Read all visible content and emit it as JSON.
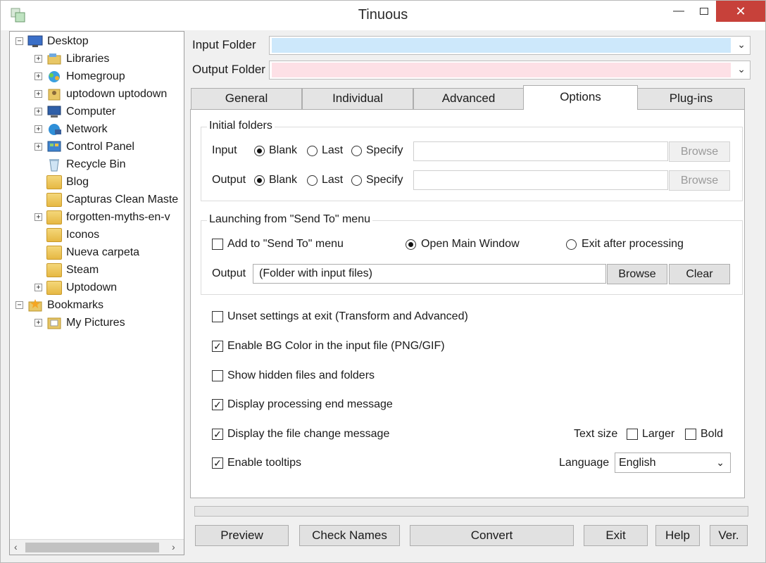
{
  "window": {
    "title": "Tinuous"
  },
  "tree": {
    "items": [
      {
        "label": "Desktop",
        "icon": "desktop-icon"
      },
      {
        "label": "Libraries",
        "icon": "libraries-icon"
      },
      {
        "label": "Homegroup",
        "icon": "homegroup-icon"
      },
      {
        "label": "uptodown uptodown",
        "icon": "user-folder-icon"
      },
      {
        "label": "Computer",
        "icon": "computer-icon"
      },
      {
        "label": "Network",
        "icon": "network-icon"
      },
      {
        "label": "Control Panel",
        "icon": "control-panel-icon"
      },
      {
        "label": "Recycle Bin",
        "icon": "recycle-bin-icon"
      },
      {
        "label": "Blog",
        "icon": "folder-icon"
      },
      {
        "label": "Capturas Clean Maste",
        "icon": "folder-icon"
      },
      {
        "label": "forgotten-myths-en-v",
        "icon": "folder-icon"
      },
      {
        "label": "Iconos",
        "icon": "folder-icon"
      },
      {
        "label": "Nueva carpeta",
        "icon": "folder-icon"
      },
      {
        "label": "Steam",
        "icon": "folder-icon"
      },
      {
        "label": "Uptodown",
        "icon": "folder-icon"
      },
      {
        "label": "Bookmarks",
        "icon": "bookmarks-icon"
      },
      {
        "label": "My Pictures",
        "icon": "pictures-folder-icon"
      }
    ]
  },
  "folders": {
    "input_label": "Input Folder",
    "input_value": "",
    "input_color": "#cde8fb",
    "output_label": "Output Folder",
    "output_value": "",
    "output_color": "#fde0e6"
  },
  "tabs": [
    {
      "label": "General"
    },
    {
      "label": "Individual"
    },
    {
      "label": "Advanced"
    },
    {
      "label": "Options"
    },
    {
      "label": "Plug-ins"
    }
  ],
  "active_tab": "Options",
  "options": {
    "initial_folders": {
      "title": "Initial folders",
      "input_label": "Input",
      "output_label": "Output",
      "blank": "Blank",
      "last": "Last",
      "specify": "Specify",
      "browse": "Browse",
      "input_selected": "Blank",
      "output_selected": "Blank"
    },
    "send_to": {
      "title": "Launching from \"Send To\" menu",
      "add_label": "Add to \"Send To\" menu",
      "add_checked": false,
      "open_main": "Open Main Window",
      "exit_after": "Exit after processing",
      "selected": "Open Main Window",
      "output_label": "Output",
      "output_value": "(Folder with input files)",
      "browse": "Browse",
      "clear": "Clear"
    },
    "checks": [
      {
        "label": "Unset settings at exit (Transform and Advanced)",
        "checked": false
      },
      {
        "label": "Enable BG Color in the input file (PNG/GIF)",
        "checked": true
      },
      {
        "label": "Show hidden files and folders",
        "checked": false
      },
      {
        "label": "Display processing end message",
        "checked": true
      },
      {
        "label": "Display the file change message",
        "checked": true
      },
      {
        "label": "Enable tooltips",
        "checked": true
      }
    ],
    "text_size": {
      "label": "Text size",
      "larger": "Larger",
      "bold": "Bold"
    },
    "language": {
      "label": "Language",
      "value": "English"
    }
  },
  "buttons": {
    "preview": "Preview",
    "check_names": "Check Names",
    "convert": "Convert",
    "exit": "Exit",
    "help": "Help",
    "ver": "Ver."
  }
}
